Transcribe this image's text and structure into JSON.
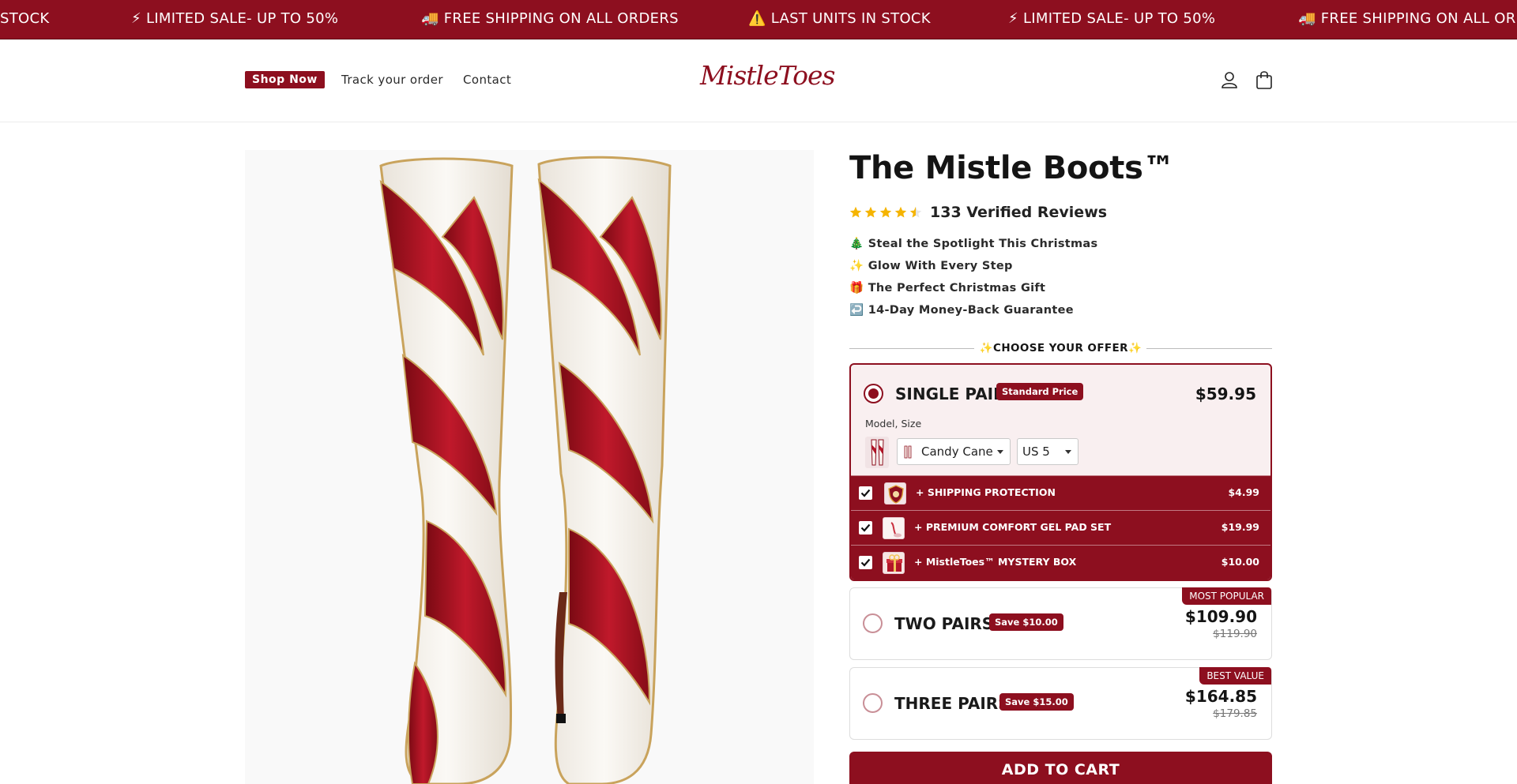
{
  "announcement": {
    "items": [
      {
        "icon": "warning-icon",
        "text": "STOCK"
      },
      {
        "icon": "lightning-icon",
        "text": "⚡ LIMITED SALE- UP TO 50%"
      },
      {
        "icon": "truck-icon",
        "text": "🚚 FREE SHIPPING ON ALL ORDERS"
      },
      {
        "icon": "warning-icon",
        "text": "⚠️ LAST UNITS IN STOCK"
      },
      {
        "icon": "lightning-icon",
        "text": "⚡ LIMITED SALE- UP TO 50%"
      },
      {
        "icon": "truck-icon",
        "text": "🚚 FREE SHIPPING ON ALL ORD"
      }
    ],
    "background": "#8d0f1f"
  },
  "header": {
    "shop_now": "Shop Now",
    "track_order": "Track your order",
    "contact": "Contact",
    "logo": "MistleToes",
    "icons": [
      "account-icon",
      "cart-icon"
    ]
  },
  "product": {
    "title": "The Mistle Boots™",
    "rating": 4.5,
    "rating_text": "133 Verified Reviews",
    "bullets": [
      "🎄 Steal the Spotlight This Christmas",
      "✨ Glow With Every Step",
      "🎁 The Perfect Christmas Gift",
      "↩️ 14-Day Money-Back Guarantee"
    ],
    "offer_heading": "✨CHOOSE YOUR OFFER✨"
  },
  "offers": {
    "single": {
      "name": "SINGLE PAIR",
      "badge": "Standard Price",
      "price": "$59.95",
      "model_label": "Model, Size",
      "model_value": "Candy Cane",
      "size_value": "US 5",
      "selected": true
    },
    "addons": [
      {
        "label": "+ SHIPPING PROTECTION",
        "price": "$4.99",
        "checked": true,
        "icon": "shield-icon"
      },
      {
        "label": "+ PREMIUM COMFORT GEL PAD SET",
        "price": "$19.99",
        "checked": true,
        "icon": "gel-pad-icon"
      },
      {
        "label": "+ MistleToes™ MYSTERY BOX",
        "price": "$10.00",
        "checked": true,
        "icon": "gift-box-icon"
      }
    ],
    "two": {
      "name": "TWO PAIRS",
      "badge": "Save $10.00",
      "price": "$109.90",
      "old_price": "$119.90",
      "tag": "MOST POPULAR"
    },
    "three": {
      "name": "THREE PAIRS",
      "badge": "Save $15.00",
      "price": "$164.85",
      "old_price": "$179.85",
      "tag": "BEST VALUE"
    }
  },
  "cart": {
    "label": "ADD TO CART"
  },
  "colors": {
    "brand": "#8d0f1f",
    "star": "#f5b400"
  }
}
